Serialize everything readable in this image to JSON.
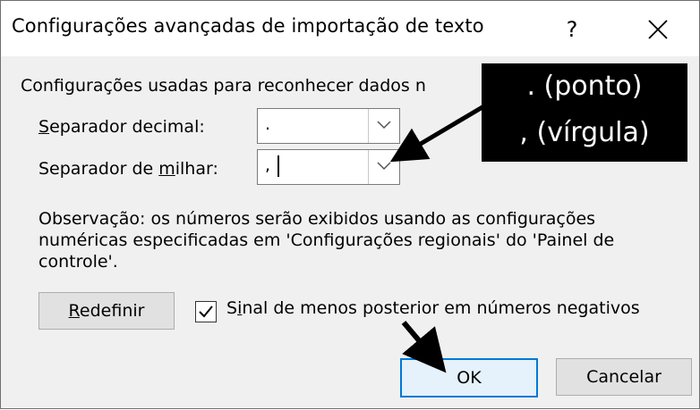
{
  "window": {
    "title": "Configurações avançadas de importação de texto",
    "help_label": "?"
  },
  "intro": "Configurações usadas para reconhecer dados n",
  "fields": {
    "decimal": {
      "label_prefix": "S",
      "label_rest": "eparador decimal:",
      "value": "."
    },
    "thousands": {
      "label_pre": "Separador de ",
      "label_u": "m",
      "label_post": "ilhar:",
      "value": ","
    }
  },
  "note": "Observação: os números serão exibidos usando as configurações numéricas especificadas em 'Configurações regionais' do 'Painel de controle'.",
  "buttons": {
    "reset_u": "R",
    "reset_rest": "edefinir",
    "ok": "OK",
    "cancel": "Cancelar"
  },
  "checkbox": {
    "checked": true,
    "label_pre": "S",
    "label_u": "i",
    "label_post": "nal de menos posterior em números negativos"
  },
  "annotation": {
    "line1": ". (ponto)",
    "line2": ", (vírgula)",
    "background": "#000000",
    "text_color": "#ffffff"
  }
}
